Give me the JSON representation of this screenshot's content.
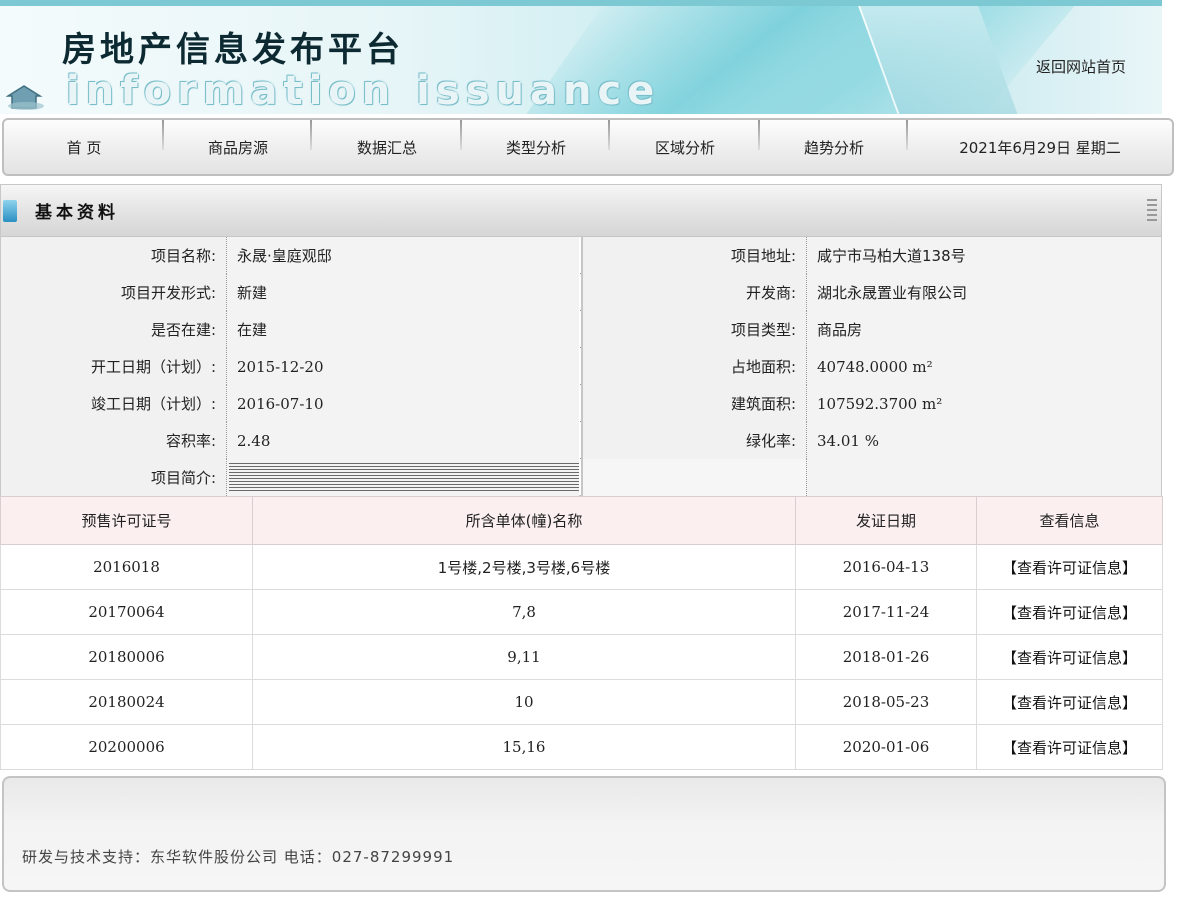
{
  "header": {
    "site_title": "房地产信息发布平台",
    "subtitle": "information issuance",
    "home_link": "返回网站首页"
  },
  "nav": {
    "items": [
      "首 页",
      "商品房源",
      "数据汇总",
      "类型分析",
      "区域分析",
      "趋势分析"
    ],
    "date": "2021年6月29日  星期二"
  },
  "section": {
    "title": "基本资料"
  },
  "info": {
    "project_name_label": "项目名称:",
    "project_name": "永晟·皇庭观邸",
    "project_address_label": "项目地址:",
    "project_address": "咸宁市马柏大道138号",
    "dev_form_label": "项目开发形式:",
    "dev_form": "新建",
    "developer_label": "开发商:",
    "developer": "湖北永晟置业有限公司",
    "under_construction_label": "是否在建:",
    "under_construction": "在建",
    "project_type_label": "项目类型:",
    "project_type": "商品房",
    "start_date_label": "开工日期（计划）:",
    "start_date": "2015-12-20",
    "land_area_label": "占地面积:",
    "land_area": "40748.0000 m²",
    "finish_date_label": "竣工日期（计划）:",
    "finish_date": "2016-07-10",
    "building_area_label": "建筑面积:",
    "building_area": "107592.3700 m²",
    "plot_ratio_label": "容积率:",
    "plot_ratio": "2.48",
    "green_ratio_label": "绿化率:",
    "green_ratio": "34.01 %",
    "intro_label": "项目简介:"
  },
  "permits": {
    "headers": [
      "预售许可证号",
      "所含单体(幢)名称",
      "发证日期",
      "查看信息"
    ],
    "rows": [
      {
        "number": "2016018",
        "buildings": "1号楼,2号楼,3号楼,6号楼",
        "date": "2016-04-13",
        "link": "【查看许可证信息】"
      },
      {
        "number": "20170064",
        "buildings": "7,8",
        "date": "2017-11-24",
        "link": "【查看许可证信息】"
      },
      {
        "number": "20180006",
        "buildings": "9,11",
        "date": "2018-01-26",
        "link": "【查看许可证信息】"
      },
      {
        "number": "20180024",
        "buildings": "10",
        "date": "2018-05-23",
        "link": "【查看许可证信息】"
      },
      {
        "number": "20200006",
        "buildings": "15,16",
        "date": "2020-01-06",
        "link": "【查看许可证信息】"
      }
    ]
  },
  "footer": {
    "text": "研发与技术支持：东华软件股份公司  电话：027-87299991"
  }
}
